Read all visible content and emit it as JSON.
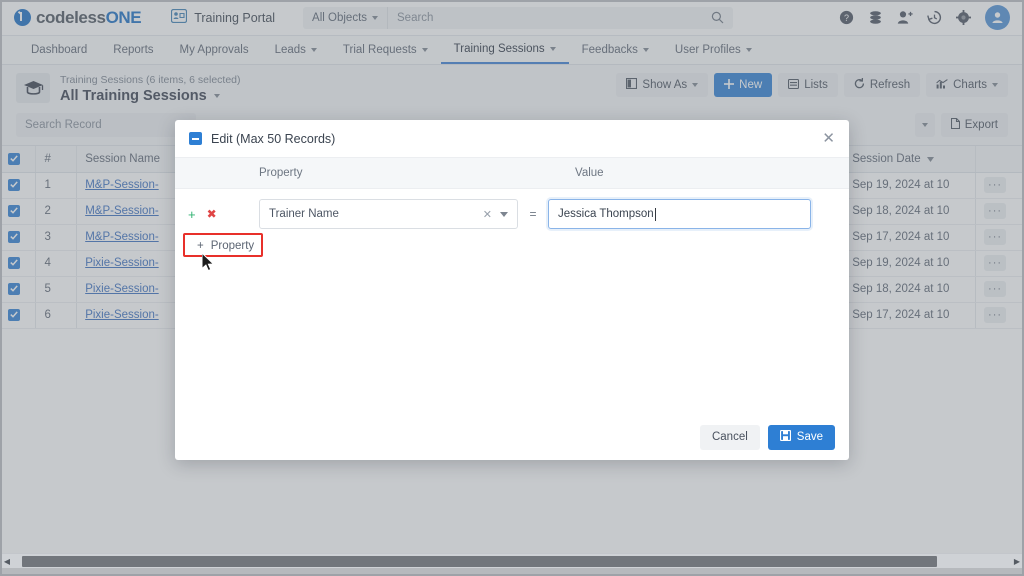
{
  "header": {
    "brand_primary": "codeless",
    "brand_secondary": "ONE",
    "portal_label": "Training Portal",
    "portal_icon": "portal-icon",
    "object_selector": "All Objects",
    "search_placeholder": "Search",
    "search_value": "",
    "icons": [
      "help-icon",
      "database-icon",
      "add-user-icon",
      "history-icon",
      "gear-icon",
      "avatar"
    ],
    "accent_color": "#2e7fd4"
  },
  "nav": {
    "tabs": [
      {
        "label": "Dashboard",
        "has_caret": false,
        "active": false
      },
      {
        "label": "Reports",
        "has_caret": false,
        "active": false
      },
      {
        "label": "My Approvals",
        "has_caret": false,
        "active": false
      },
      {
        "label": "Leads",
        "has_caret": true,
        "active": false
      },
      {
        "label": "Trial Requests",
        "has_caret": true,
        "active": false
      },
      {
        "label": "Training Sessions",
        "has_caret": true,
        "active": true
      },
      {
        "label": "Feedbacks",
        "has_caret": true,
        "active": false
      },
      {
        "label": "User Profiles",
        "has_caret": true,
        "active": false
      }
    ]
  },
  "list_header": {
    "object_icon": "graduation-cap-icon",
    "subtitle": "Training Sessions (6 items, 6 selected)",
    "title": "All Training Sessions",
    "buttons": [
      {
        "label": "Show As",
        "icon": "layout-icon",
        "caret": true,
        "primary": false
      },
      {
        "label": "New",
        "icon": "plus-icon",
        "caret": false,
        "primary": true
      },
      {
        "label": "Lists",
        "icon": "list-icon",
        "caret": false,
        "primary": false
      },
      {
        "label": "Refresh",
        "icon": "refresh-icon",
        "caret": false,
        "primary": false
      },
      {
        "label": "Charts",
        "icon": "chart-icon",
        "caret": true,
        "primary": false
      }
    ],
    "record_search_placeholder": "Search Record",
    "record_search_value": "",
    "export_label": "Export"
  },
  "grid": {
    "columns": [
      "#",
      "Session Name",
      "Session Date"
    ],
    "rows": [
      {
        "num": "1",
        "name": "M&P-Session-",
        "date": "Sep 19, 2024 at 10",
        "checked": true
      },
      {
        "num": "2",
        "name": "M&P-Session-",
        "date": "Sep 18, 2024 at 10",
        "checked": true
      },
      {
        "num": "3",
        "name": "M&P-Session-",
        "date": "Sep 17, 2024 at 10",
        "checked": true
      },
      {
        "num": "4",
        "name": "Pixie-Session-",
        "date": "Sep 19, 2024 at 10",
        "checked": true
      },
      {
        "num": "5",
        "name": "Pixie-Session-",
        "date": "Sep 18, 2024 at 10",
        "checked": true
      },
      {
        "num": "6",
        "name": "Pixie-Session-",
        "date": "Sep 17, 2024 at 10",
        "checked": true
      }
    ],
    "row_menu_label": "···"
  },
  "modal": {
    "title": "Edit (Max 50 Records)",
    "collapse_icon": "minus-square-icon",
    "close_icon": "close-icon",
    "col_property": "Property",
    "col_value": "Value",
    "row": {
      "add_icon": "plus-icon",
      "remove_icon": "remove-icon",
      "property": "Trainer Name",
      "clear_icon": "clear-icon",
      "operator": "=",
      "value": "Jessica Thompson"
    },
    "add_property_label": "Property",
    "add_property_icon": "plus-icon",
    "highlight_color": "#e8302a",
    "cancel_label": "Cancel",
    "save_label": "Save",
    "save_icon": "save-icon"
  }
}
